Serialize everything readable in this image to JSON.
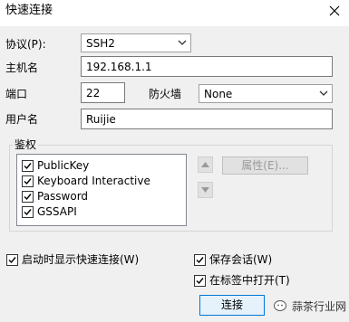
{
  "window": {
    "title": "快速连接",
    "close_glyph": "✕"
  },
  "form": {
    "protocol_label": "协议(P):",
    "protocol_value": "SSH2",
    "hostname_label": "主机名",
    "hostname_value": "192.168.1.1",
    "port_label": "端口",
    "port_value": "22",
    "firewall_label": "防火墙",
    "firewall_value": "None",
    "username_label": "用户名",
    "username_value": "Ruijie"
  },
  "auth": {
    "group_label": "鉴权",
    "methods": [
      {
        "label": "PublicKey",
        "checked": true
      },
      {
        "label": "Keyboard Interactive",
        "checked": true
      },
      {
        "label": "Password",
        "checked": true
      },
      {
        "label": "GSSAPI",
        "checked": true
      }
    ],
    "properties_label": "属性(E)..."
  },
  "options": {
    "show_on_startup_label": "启动时显示快速连接(W)",
    "show_on_startup_checked": true,
    "save_session_label": "保存会话(W)",
    "save_session_checked": true,
    "open_in_tab_label": "在标签中打开(T)",
    "open_in_tab_checked": true
  },
  "buttons": {
    "connect_label": "连接"
  },
  "watermark": {
    "text": "蒜茶行业网"
  }
}
